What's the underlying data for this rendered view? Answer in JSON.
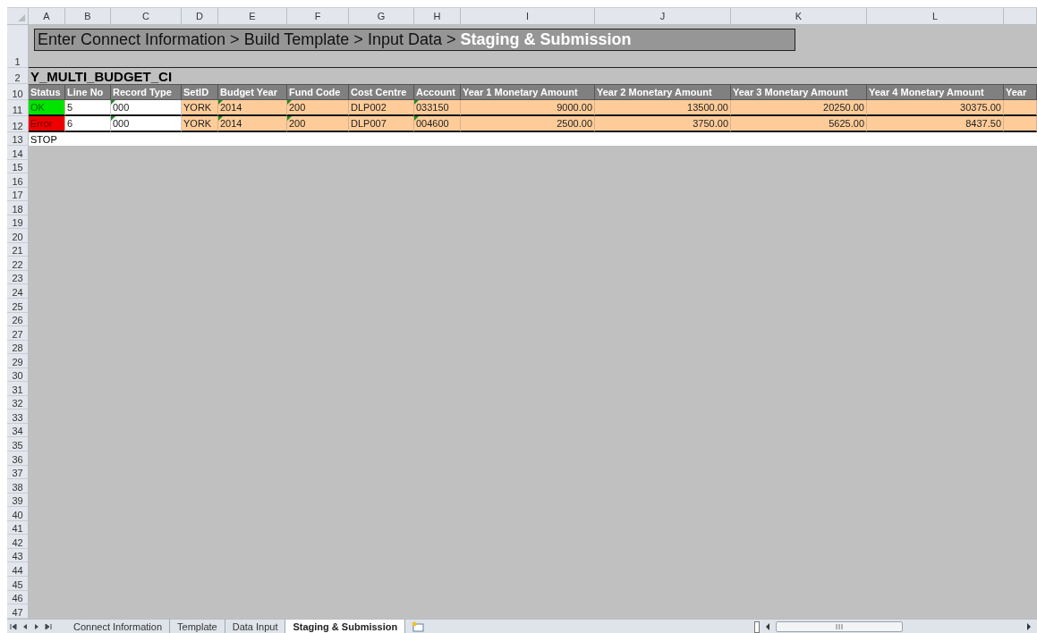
{
  "column_letters": [
    "A",
    "B",
    "C",
    "D",
    "E",
    "F",
    "G",
    "H",
    "I",
    "J",
    "K",
    "L"
  ],
  "row_numbers": [
    "1",
    "2",
    "10",
    "11",
    "12",
    "13",
    "14",
    "15",
    "16",
    "17",
    "18",
    "19",
    "20",
    "21",
    "22",
    "23",
    "24",
    "25",
    "26",
    "27",
    "28",
    "29",
    "30",
    "31",
    "32",
    "33",
    "34",
    "35",
    "36",
    "37",
    "38",
    "39",
    "40",
    "41",
    "42",
    "43",
    "44",
    "45",
    "46",
    "47"
  ],
  "banner": "Enter Connect Information > Build Template > Input Data > **Staging & Submission**",
  "sheet_title": "Y_MULTI_BUDGET_CI",
  "table": {
    "columns": [
      "Status",
      "Line No",
      "Record Type",
      "SetID",
      "Budget Year",
      "Fund Code",
      "Cost Centre",
      "Account",
      "Year 1 Monetary Amount",
      "Year 2  Monetary Amount",
      "Year 3 Monetary Amount",
      "Year 4 Monetary Amount",
      "Year"
    ],
    "rows": [
      {
        "kind": "ok",
        "cells": [
          {
            "text": "OK"
          },
          {
            "text": "5",
            "flagged": false
          },
          {
            "text": "000",
            "flagged": true
          },
          {
            "text": "YORK",
            "flagged": false
          },
          {
            "text": "2014",
            "flagged": true
          },
          {
            "text": "200",
            "flagged": true
          },
          {
            "text": "DLP002",
            "flagged": false
          },
          {
            "text": "033150",
            "flagged": true
          },
          {
            "text": "9000.00",
            "flagged": false
          },
          {
            "text": "13500.00",
            "flagged": false
          },
          {
            "text": "20250.00",
            "flagged": false
          },
          {
            "text": "30375.00",
            "flagged": false
          }
        ]
      },
      {
        "kind": "error",
        "cells": [
          {
            "text": "Error"
          },
          {
            "text": "6",
            "flagged": false
          },
          {
            "text": "000",
            "flagged": true
          },
          {
            "text": "YORK",
            "flagged": false
          },
          {
            "text": "2014",
            "flagged": true
          },
          {
            "text": "200",
            "flagged": true
          },
          {
            "text": "DLP007",
            "flagged": false
          },
          {
            "text": "004600",
            "flagged": true
          },
          {
            "text": "2500.00",
            "flagged": false
          },
          {
            "text": "3750.00",
            "flagged": false
          },
          {
            "text": "5625.00",
            "flagged": false
          },
          {
            "text": "8437.50",
            "flagged": false
          }
        ]
      }
    ],
    "stop_label": "STOP"
  },
  "sheet_tabs": [
    {
      "label": "Connect Information",
      "selected": false
    },
    {
      "label": "Template",
      "selected": false
    },
    {
      "label": "Data Input",
      "selected": false
    },
    {
      "label": "Staging & Submission",
      "selected": true
    }
  ]
}
